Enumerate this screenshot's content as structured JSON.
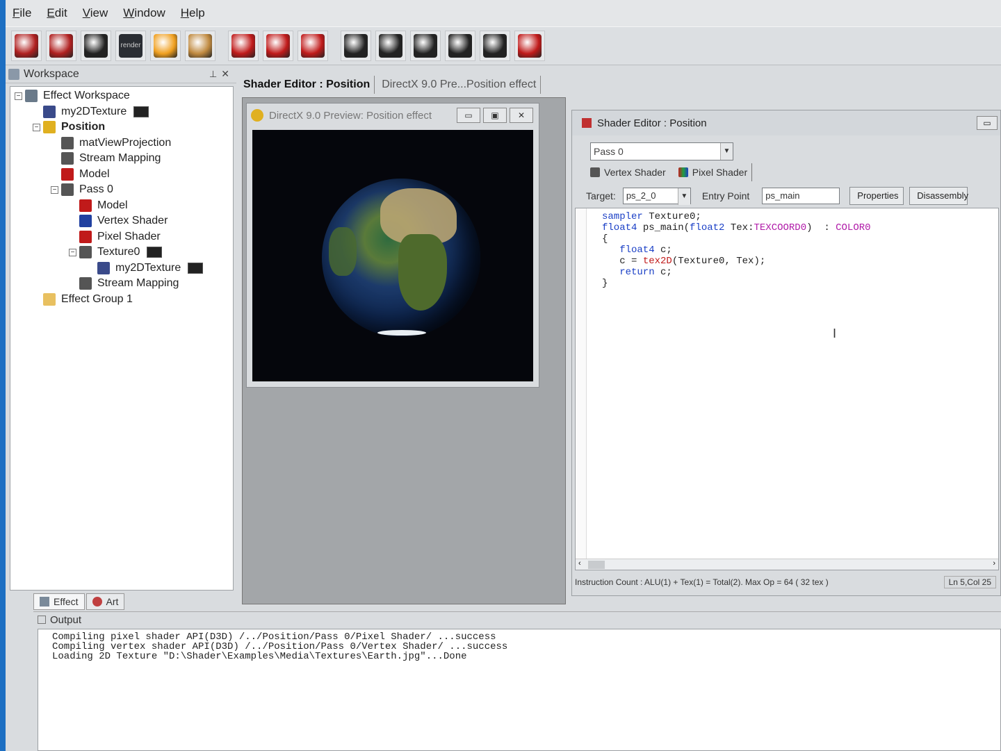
{
  "menu": [
    "File",
    "Edit",
    "View",
    "Window",
    "Help"
  ],
  "toolbar": {
    "buttons": [
      {
        "name": "new-effect-icon",
        "color": "#b02020"
      },
      {
        "name": "open-effect-icon",
        "color": "#b02020"
      },
      {
        "name": "stream-icon",
        "color": "#222222"
      },
      {
        "name": "render-icon",
        "color": "#333333",
        "label": "render"
      },
      {
        "name": "sphere-icon",
        "color": "#f0a020"
      },
      {
        "name": "palette-icon",
        "color": "#c08a40"
      },
      {
        "name": "model-icon",
        "color": "#c01a1a"
      },
      {
        "name": "vertex-shader-icon",
        "color": "#c01a1a"
      },
      {
        "name": "pixel-shader-icon",
        "color": "#c01a1a"
      },
      {
        "name": "camera-icon",
        "color": "#222222"
      },
      {
        "name": "camera-icon",
        "color": "#222222"
      },
      {
        "name": "camera-icon",
        "color": "#222222"
      },
      {
        "name": "camera-icon",
        "color": "#222222"
      },
      {
        "name": "camera-icon",
        "color": "#222222"
      },
      {
        "name": "mouse-icon",
        "color": "#c01a1a"
      }
    ]
  },
  "workspace": {
    "title": "Workspace",
    "tree": [
      {
        "label": "Effect Workspace",
        "level": 0,
        "expander": "−",
        "icon": "workspace-icon",
        "color": "#6a7a8a"
      },
      {
        "label": "my2DTexture",
        "level": 1,
        "icon": "texture-icon",
        "color": "#3a4a8a",
        "thumb": true
      },
      {
        "label": "Position",
        "level": 1,
        "expander": "−",
        "icon": "effect-icon",
        "color": "#e0b020",
        "bold": true
      },
      {
        "label": "matViewProjection",
        "level": 2,
        "icon": "matrix-icon",
        "color": "#555555"
      },
      {
        "label": "Stream Mapping",
        "level": 2,
        "icon": "stream-mapping-icon",
        "color": "#555555"
      },
      {
        "label": "Model",
        "level": 2,
        "icon": "model-icon",
        "color": "#c01a1a"
      },
      {
        "label": "Pass 0",
        "level": 2,
        "expander": "−",
        "icon": "pass-icon",
        "color": "#555555"
      },
      {
        "label": "Model",
        "level": 3,
        "icon": "model-icon",
        "color": "#c01a1a"
      },
      {
        "label": "Vertex Shader",
        "level": 3,
        "icon": "vertex-shader-icon",
        "color": "#2040a0"
      },
      {
        "label": "Pixel Shader",
        "level": 3,
        "icon": "pixel-shader-icon",
        "color": "#c01a1a"
      },
      {
        "label": "Texture0",
        "level": 3,
        "expander": "−",
        "icon": "texture-object-icon",
        "color": "#555555",
        "thumb": true
      },
      {
        "label": "my2DTexture",
        "level": 4,
        "icon": "texture-icon",
        "color": "#3a4a8a",
        "thumb": true
      },
      {
        "label": "Stream Mapping",
        "level": 3,
        "icon": "stream-mapping-icon",
        "color": "#555555"
      },
      {
        "label": "Effect Group 1",
        "level": 1,
        "icon": "folder-icon",
        "color": "#e8c060"
      }
    ],
    "tabs": [
      "Effect",
      "Art"
    ]
  },
  "doc_tabs": [
    "Shader Editor : Position",
    "DirectX 9.0 Pre...Position effect"
  ],
  "preview": {
    "title": "DirectX 9.0 Preview: Position effect"
  },
  "shader_editor": {
    "title": "Shader Editor : Position",
    "pass": "Pass 0",
    "tabs": [
      "Vertex Shader",
      "Pixel Shader"
    ],
    "target_label": "Target:",
    "target_value": "ps_2_0",
    "entry_label": "Entry Point",
    "entry_value": "ps_main",
    "properties_label": "Properties",
    "disassembly_label": "Disassembly",
    "code": {
      "l1a": "sampler",
      "l1b": " Texture0;",
      "l2a": "float4",
      "l2b": " ps_main(",
      "l2c": "float2",
      "l2d": " Tex:",
      "l2e": "TEXCOORD0",
      "l2f": ")  : ",
      "l2g": "COLOR0",
      "l3": "{",
      "l4a": "   float4",
      "l4b": " c;",
      "l5a": "   c = ",
      "l5b": "tex2D",
      "l5c": "(Texture0, Tex);",
      "l6a": "   return",
      "l6b": " c;",
      "l7": "}"
    },
    "status": "Instruction Count :  ALU(1) + Tex(1) = Total(2).  Max Op = 64 ( 32 tex )",
    "line_col": "Ln 5,Col 25"
  },
  "output": {
    "title": "Output",
    "lines": [
      "Compiling pixel shader API(D3D) /../Position/Pass 0/Pixel Shader/ ...success",
      "Compiling vertex shader API(D3D) /../Position/Pass 0/Vertex Shader/ ...success",
      "Loading 2D Texture \"D:\\Shader\\Examples\\Media\\Textures\\Earth.jpg\"...Done"
    ]
  }
}
